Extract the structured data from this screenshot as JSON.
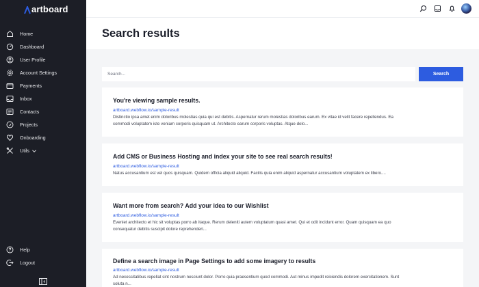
{
  "brand": {
    "name": "artboard",
    "accent": "#2d5ce0"
  },
  "sidebar": {
    "items": [
      {
        "label": "Home",
        "icon": "home-icon"
      },
      {
        "label": "Dashboard",
        "icon": "dashboard-icon"
      },
      {
        "label": "User Profile",
        "icon": "user-icon"
      },
      {
        "label": "Account Settings",
        "icon": "gear-icon"
      },
      {
        "label": "Payments",
        "icon": "wallet-icon"
      },
      {
        "label": "Inbox",
        "icon": "inbox-icon"
      },
      {
        "label": "Contacts",
        "icon": "contacts-icon"
      },
      {
        "label": "Projects",
        "icon": "rocket-icon"
      },
      {
        "label": "Onboarding",
        "icon": "onboarding-icon"
      },
      {
        "label": "Utils",
        "icon": "tools-icon"
      }
    ],
    "bottom": [
      {
        "label": "Help",
        "icon": "help-icon"
      },
      {
        "label": "Logout",
        "icon": "logout-icon"
      }
    ]
  },
  "main": {
    "title": "Search results",
    "search": {
      "placeholder": "Search...",
      "button_label": "Search"
    },
    "results": [
      {
        "title": "You're viewing sample results.",
        "url": "artboard.webflow.io/sample-result",
        "description_lines": [
          "Distinctio ipsa amet enim doloribus molestias quia qui est debitis. Aspernatur rerum molestias doloribus earum. Ex vitae id velit facere repellendus. Ea",
          "commodi voluptatem iste veniam corporis quisquam ut. Architecto earum corporis voluptas. Atque dolo..."
        ]
      },
      {
        "title": "Add CMS or Business Hosting and index your site to see real search results!",
        "url": "artboard.webflow.io/sample-result",
        "description_lines": [
          "Natus accusantium est vel quos quisquam. Quidem officia aliquid aliquid. Facilis quia enim aliquid aspernatur accusantium voluptatem ex libero...."
        ]
      },
      {
        "title": "Want more from search? Add your idea to our Wishlist",
        "url": "artboard.webflow.io/sample-result",
        "description_lines": [
          "Eveniet architecto et hic sit voluptas porro ab itaque. Rerum deleniti autem voluptatum quasi amet. Qui et odit incidunt error. Quam quisquam ea quo",
          "consequatur debitis suscipit dolore reprehenderi..."
        ]
      },
      {
        "title": "Define a search image in Page Settings to add some imagery to results",
        "url": "artboard.webflow.io/sample-result",
        "description_lines": [
          "Ad necessitatibus repellat sint nostrum nesciunt dolor. Porro quia praesentium quod commodi. Aut minus impedit reiciendis dolorem exercitationem. Sunt",
          "soluta n..."
        ]
      }
    ]
  }
}
